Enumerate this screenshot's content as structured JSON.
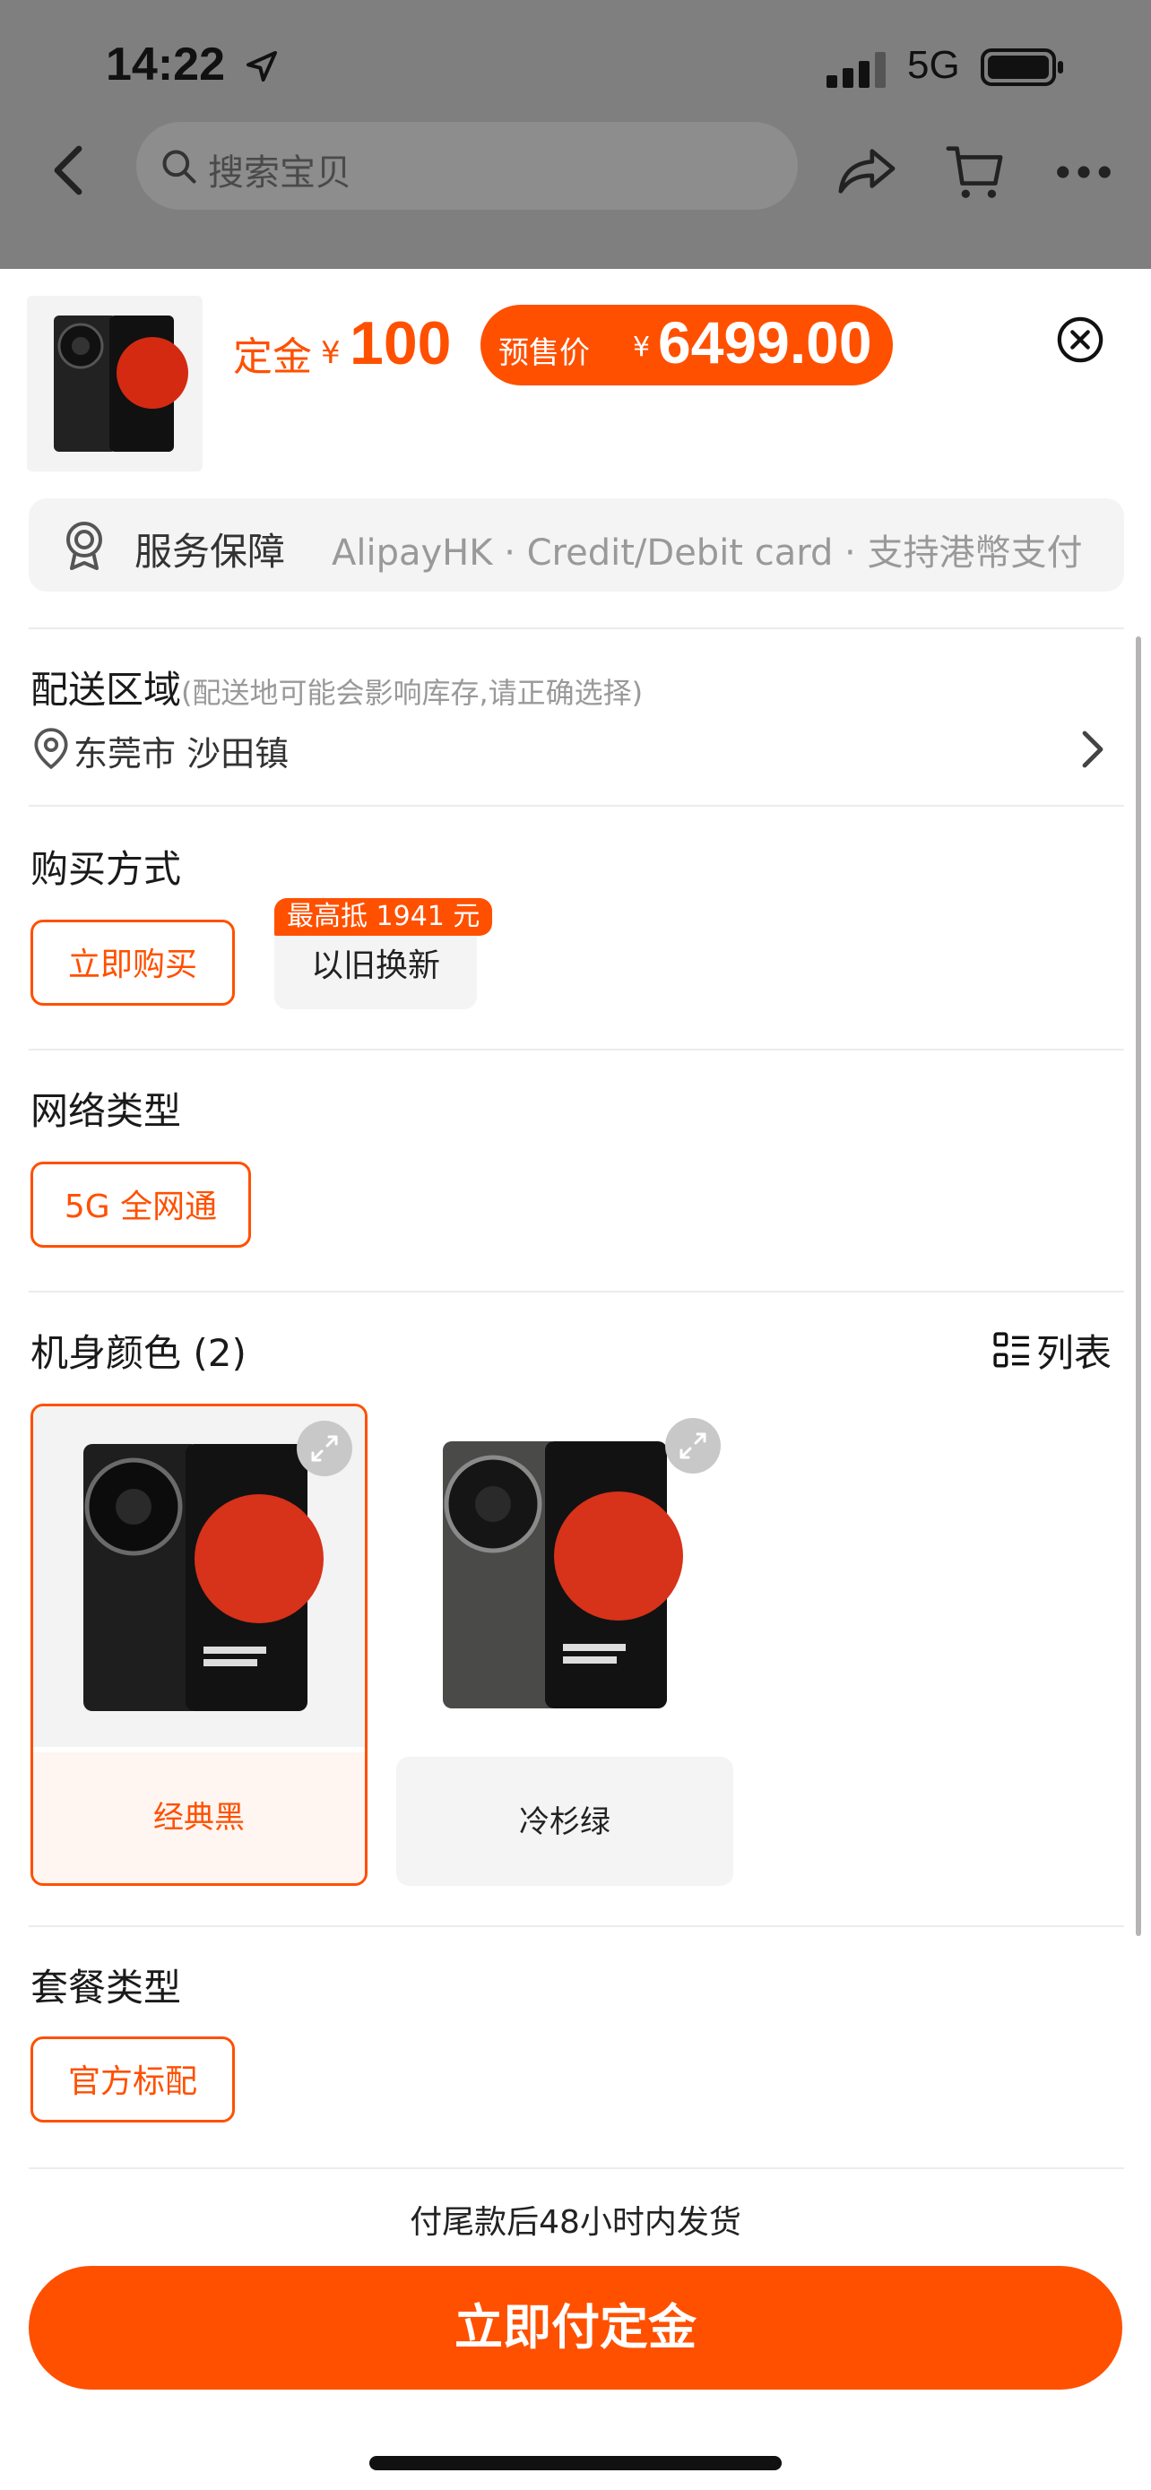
{
  "status_bar": {
    "time": "14:22",
    "network": "5G"
  },
  "top_nav": {
    "search_placeholder": "搜索宝贝"
  },
  "product": {
    "deposit_label": "定金",
    "deposit_currency": "¥",
    "deposit_value": "100",
    "presale_label": "预售价",
    "presale_currency": "¥",
    "presale_value": "6499.00"
  },
  "service": {
    "title": "服务保障",
    "detail": "AlipayHK · Credit/Debit card · 支持港幣支付"
  },
  "delivery": {
    "title": "配送区域",
    "hint": "(配送地可能会影响库存,请正确选择)",
    "address": "东莞市 沙田镇"
  },
  "purchase_method": {
    "title": "购买方式",
    "options": [
      {
        "label": "立即购买",
        "selected": true
      },
      {
        "label": "以旧换新",
        "selected": false,
        "badge": "最高抵 1941 元"
      }
    ]
  },
  "network_type": {
    "title": "网络类型",
    "options": [
      {
        "label": "5G 全网通",
        "selected": true
      }
    ]
  },
  "body_color": {
    "title": "机身颜色 (2)",
    "list_toggle": "列表",
    "options": [
      {
        "label": "经典黑",
        "selected": true
      },
      {
        "label": "冷杉绿",
        "selected": false
      }
    ]
  },
  "package_type": {
    "title": "套餐类型",
    "options": [
      {
        "label": "官方标配",
        "selected": true
      }
    ]
  },
  "footer": {
    "shipping_note": "付尾款后48小时内发货",
    "pay_button": "立即付定金"
  },
  "colors": {
    "accent": "#ff5000",
    "backdrop": "#7f7f7f",
    "chip_bg": "#f4f4f4"
  },
  "icons": [
    "location-arrow-icon",
    "signal-icon",
    "battery-icon",
    "back-icon",
    "search-icon",
    "share-icon",
    "cart-icon",
    "more-icon",
    "close-icon",
    "service-badge-icon",
    "location-pin-icon",
    "chevron-right-icon",
    "list-view-icon",
    "expand-icon"
  ]
}
